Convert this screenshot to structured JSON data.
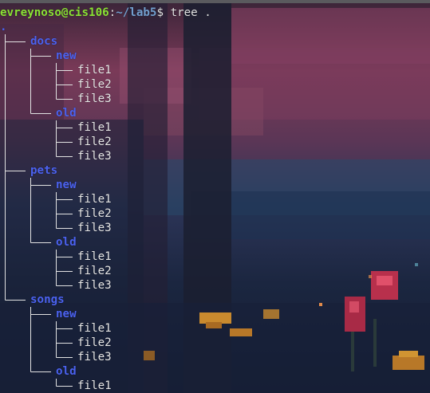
{
  "prompt": {
    "user_host": "evreynoso@cis106",
    "separator": ":",
    "path": "~/lab5",
    "symbol": "$",
    "command": "tree ."
  },
  "tree": {
    "root": ".",
    "dirs": [
      {
        "name": "docs",
        "subdirs": [
          {
            "name": "new",
            "files": [
              "file1",
              "file2",
              "file3"
            ]
          },
          {
            "name": "old",
            "files": [
              "file1",
              "file2",
              "file3"
            ]
          }
        ]
      },
      {
        "name": "pets",
        "subdirs": [
          {
            "name": "new",
            "files": [
              "file1",
              "file2",
              "file3"
            ]
          },
          {
            "name": "old",
            "files": [
              "file1",
              "file2",
              "file3"
            ]
          }
        ]
      },
      {
        "name": "songs",
        "subdirs": [
          {
            "name": "new",
            "files": [
              "file1",
              "file2",
              "file3"
            ]
          },
          {
            "name": "old",
            "files": [
              "file1"
            ]
          }
        ]
      }
    ]
  },
  "colors": {
    "prompt_user": "#8ae234",
    "prompt_path": "#729fcf",
    "directory": "#4b62f0",
    "file": "#e6e6e6"
  }
}
